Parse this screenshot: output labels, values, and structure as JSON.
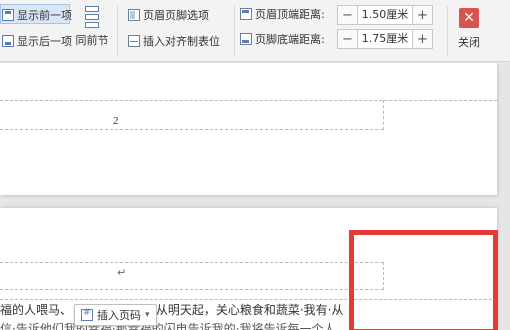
{
  "ribbon": {
    "show_prev": "显示前一项",
    "show_next": "显示后一项",
    "same_as_previous": "同前节",
    "header_footer_options": "页眉页脚选项",
    "insert_alignment_tab": "插入对齐制表位",
    "header_top_distance_label": "页眉顶端距离:",
    "header_top_distance_value": "1.50厘米",
    "footer_bottom_distance_label": "页脚底端距离:",
    "footer_bottom_distance_value": "1.75厘米",
    "minus": "−",
    "plus": "+",
    "close_label": "关闭",
    "close_glyph": "✕"
  },
  "document": {
    "page_number": "2",
    "paragraph_mark": "↵",
    "body_line_1_left": "福的人喂马、",
    "body_line_1_right": "·从明天起，关心粮食和蔬菜·我有·从",
    "body_line_2": "信·告诉他们我的幸福·那幸福的闪电告诉我的·我将告诉每一个人",
    "insert_page_number_button": "插入页码",
    "caret": "▾"
  },
  "colors": {
    "accent_blue": "#5b7fb3",
    "close_red": "#d9534f",
    "highlight_red": "#e53935"
  }
}
